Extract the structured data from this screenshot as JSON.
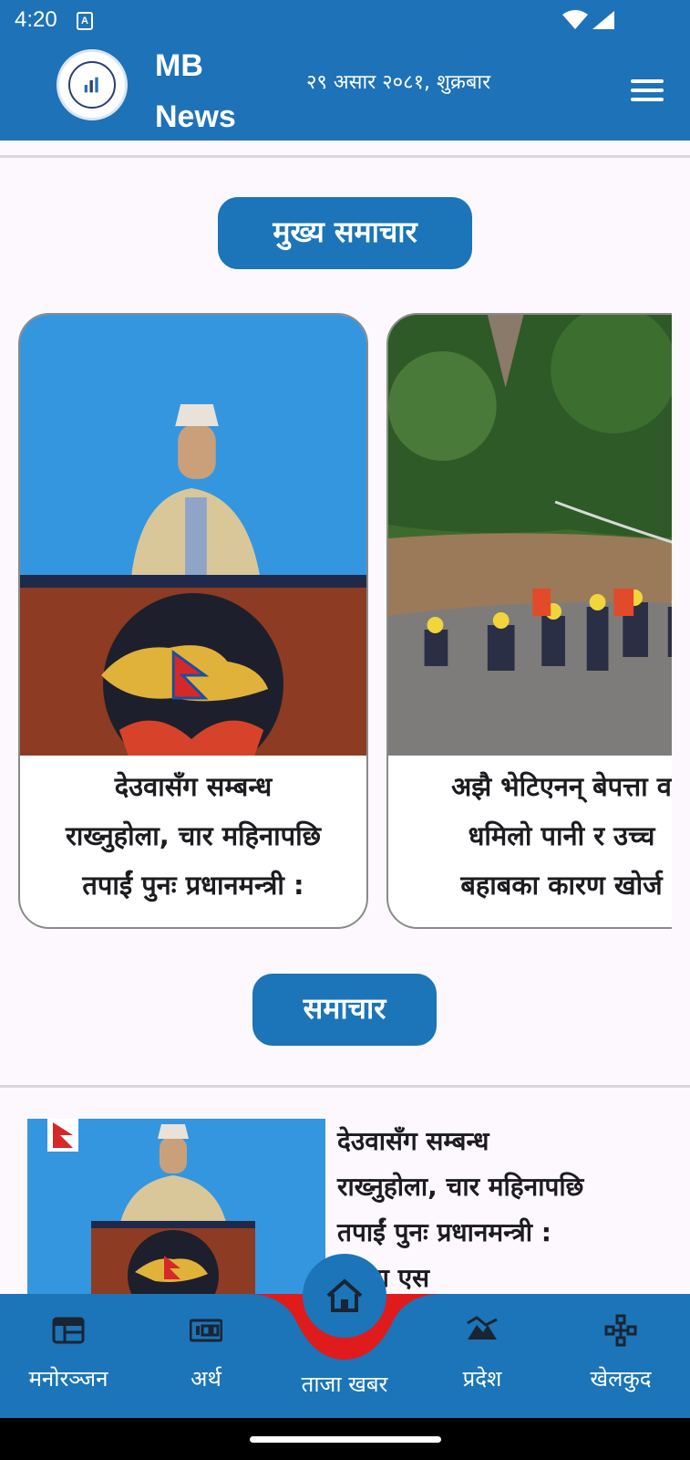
{
  "status_bar": {
    "time": "4:20",
    "a_badge": "A"
  },
  "app_bar": {
    "title": "MB\nNews",
    "date": "२९ असार २०८१, शुक्रबार",
    "logo_icon": "mb-news-logo-icon",
    "menu_icon": "hamburger-menu-icon"
  },
  "sections": {
    "headlines": "मुख्य समाचार",
    "news": "समाचार"
  },
  "carousel": [
    {
      "lines": [
        "देउवासँग सम्बन्ध",
        "राख्नुहोला, चार महिनापछि",
        "तपाईं पुनः प्रधानमन्त्री :"
      ]
    },
    {
      "lines": [
        "अझै भेटिएनन् बेपत्ता व",
        "धमिलो पानी र उच्च",
        "बहाबका कारण खोर्ज"
      ]
    }
  ],
  "news_list": [
    {
      "lines": [
        "देउवासँग सम्बन्ध",
        "राख्नुहोला, चार महिनापछि",
        "तपाईं पुनः प्रधानमन्त्री :",
        "मा पा एस"
      ]
    }
  ],
  "bottom_nav": [
    {
      "label": "मनोरञ्जन",
      "icon": "entertainment-icon"
    },
    {
      "label": "अर्थ",
      "icon": "economy-icon"
    },
    {
      "label": "ताजा खबर",
      "icon": "home-icon"
    },
    {
      "label": "प्रदेश",
      "icon": "province-icon"
    },
    {
      "label": "खेलकुद",
      "icon": "sports-icon"
    }
  ],
  "colors": {
    "primary": "#1b75b8",
    "wave": "#e01b1b"
  }
}
